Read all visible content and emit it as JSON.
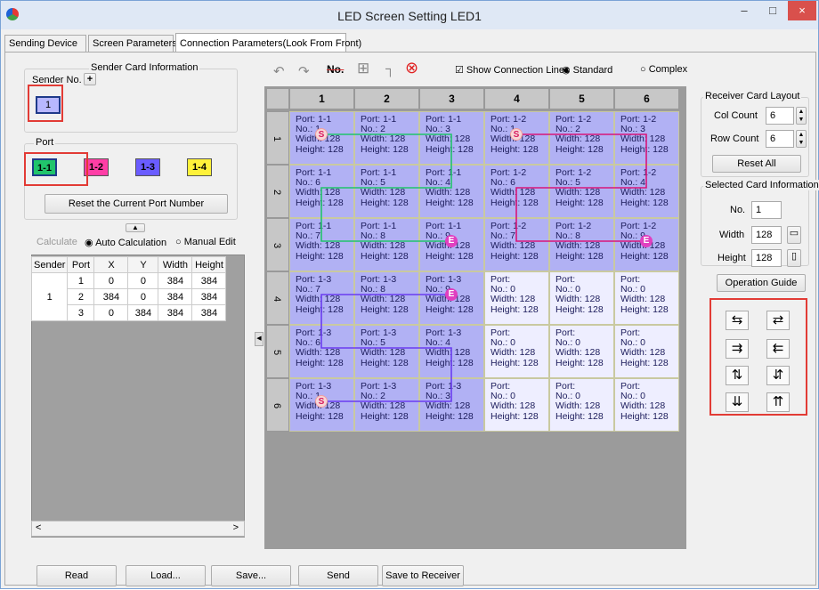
{
  "window": {
    "title": "LED Screen Setting LED1",
    "minimize": "–",
    "maximize": "□",
    "close": "×"
  },
  "tabs": [
    {
      "label": "Sending Device"
    },
    {
      "label": "Screen Parameters"
    },
    {
      "label": "Connection Parameters(Look From Front)"
    }
  ],
  "sender_group": {
    "title": "Sender Card Information",
    "sender_no_label": "Sender No.",
    "add": "+",
    "sender_value": "1"
  },
  "port_group": {
    "title": "Port",
    "ports": [
      "1-1",
      "1-2",
      "1-3",
      "1-4"
    ],
    "port_colors": [
      "#21c46b",
      "#ff3ea6",
      "#6a5cff",
      "#fff23a"
    ],
    "reset_button": "Reset the Current Port Number"
  },
  "calc": {
    "calculate": "Calculate",
    "auto": "Auto Calculation",
    "manual": "Manual Edit"
  },
  "table": {
    "headers": [
      "Sender",
      "Port",
      "X",
      "Y",
      "Width",
      "Height"
    ],
    "sender": "1",
    "rows": [
      [
        "1",
        "0",
        "0",
        "384",
        "384"
      ],
      [
        "2",
        "384",
        "0",
        "384",
        "384"
      ],
      [
        "3",
        "0",
        "384",
        "384",
        "384"
      ]
    ],
    "scroll_left": "<",
    "scroll_right": ">"
  },
  "toolbar": {
    "undo": "↶",
    "redo": "↷",
    "no": "No.",
    "grid": "⊞",
    "wire": "┐",
    "clear": "⊗",
    "show_lines": "Show Connection Lines",
    "standard": "Standard",
    "complex": "Complex"
  },
  "grid": {
    "columns": [
      "1",
      "2",
      "3",
      "4",
      "5",
      "6"
    ],
    "rows": [
      "1",
      "2",
      "3",
      "4",
      "5",
      "6"
    ],
    "cells": [
      [
        [
          "Port: 1-1",
          "No.: 1",
          "Width: 128",
          "Height: 128"
        ],
        [
          "Port: 1-1",
          "No.: 2",
          "Width: 128",
          "Height: 128"
        ],
        [
          "Port: 1-1",
          "No.: 3",
          "Width: 128",
          "Height: 128"
        ],
        [
          "Port: 1-2",
          "No.: 1",
          "Width: 128",
          "Height: 128"
        ],
        [
          "Port: 1-2",
          "No.: 2",
          "Width: 128",
          "Height: 128"
        ],
        [
          "Port: 1-2",
          "No.: 3",
          "Width: 128",
          "Height: 128"
        ]
      ],
      [
        [
          "Port: 1-1",
          "No.: 6",
          "Width: 128",
          "Height: 128"
        ],
        [
          "Port: 1-1",
          "No.: 5",
          "Width: 128",
          "Height: 128"
        ],
        [
          "Port: 1-1",
          "No.: 4",
          "Width: 128",
          "Height: 128"
        ],
        [
          "Port: 1-2",
          "No.: 6",
          "Width: 128",
          "Height: 128"
        ],
        [
          "Port: 1-2",
          "No.: 5",
          "Width: 128",
          "Height: 128"
        ],
        [
          "Port: 1-2",
          "No.: 4",
          "Width: 128",
          "Height: 128"
        ]
      ],
      [
        [
          "Port: 1-1",
          "No.: 7",
          "Width: 128",
          "Height: 128"
        ],
        [
          "Port: 1-1",
          "No.: 8",
          "Width: 128",
          "Height: 128"
        ],
        [
          "Port: 1-1",
          "No.: 9",
          "Width: 128",
          "Height: 128"
        ],
        [
          "Port: 1-2",
          "No.: 7",
          "Width: 128",
          "Height: 128"
        ],
        [
          "Port: 1-2",
          "No.: 8",
          "Width: 128",
          "Height: 128"
        ],
        [
          "Port: 1-2",
          "No.: 9",
          "Width: 128",
          "Height: 128"
        ]
      ],
      [
        [
          "Port: 1-3",
          "No.: 7",
          "Width: 128",
          "Height: 128"
        ],
        [
          "Port: 1-3",
          "No.: 8",
          "Width: 128",
          "Height: 128"
        ],
        [
          "Port: 1-3",
          "No.: 9",
          "Width: 128",
          "Height: 128"
        ],
        [
          "Port:",
          "No.: 0",
          "Width: 128",
          "Height: 128"
        ],
        [
          "Port:",
          "No.: 0",
          "Width: 128",
          "Height: 128"
        ],
        [
          "Port:",
          "No.: 0",
          "Width: 128",
          "Height: 128"
        ]
      ],
      [
        [
          "Port: 1-3",
          "No.: 6",
          "Width: 128",
          "Height: 128"
        ],
        [
          "Port: 1-3",
          "No.: 5",
          "Width: 128",
          "Height: 128"
        ],
        [
          "Port: 1-3",
          "No.: 4",
          "Width: 128",
          "Height: 128"
        ],
        [
          "Port:",
          "No.: 0",
          "Width: 128",
          "Height: 128"
        ],
        [
          "Port:",
          "No.: 0",
          "Width: 128",
          "Height: 128"
        ],
        [
          "Port:",
          "No.: 0",
          "Width: 128",
          "Height: 128"
        ]
      ],
      [
        [
          "Port: 1-3",
          "No.: 1",
          "Width: 128",
          "Height: 128"
        ],
        [
          "Port: 1-3",
          "No.: 2",
          "Width: 128",
          "Height: 128"
        ],
        [
          "Port: 1-3",
          "No.: 3",
          "Width: 128",
          "Height: 128"
        ],
        [
          "Port:",
          "No.: 0",
          "Width: 128",
          "Height: 128"
        ],
        [
          "Port:",
          "No.: 0",
          "Width: 128",
          "Height: 128"
        ],
        [
          "Port:",
          "No.: 0",
          "Width: 128",
          "Height: 128"
        ]
      ]
    ],
    "start_marker": "S",
    "end_marker": "E",
    "line_colors": {
      "port_1_1": "#21c46b",
      "port_1_2": "#d8157a",
      "port_1_3": "#6a3cf0"
    }
  },
  "receiver_layout": {
    "title": "Receiver Card Layout",
    "col_label": "Col Count",
    "col_value": "6",
    "row_label": "Row Count",
    "row_value": "6",
    "reset_all": "Reset All"
  },
  "selected_card": {
    "title": "Selected Card Information",
    "no_label": "No.",
    "no_value": "1",
    "width_label": "Width",
    "width_value": "128",
    "height_label": "Height",
    "height_value": "128"
  },
  "operation_guide": "Operation Guide",
  "bottom": {
    "read": "Read",
    "load": "Load...",
    "save": "Save...",
    "send": "Send",
    "save_receiver": "Save to Receiver"
  }
}
